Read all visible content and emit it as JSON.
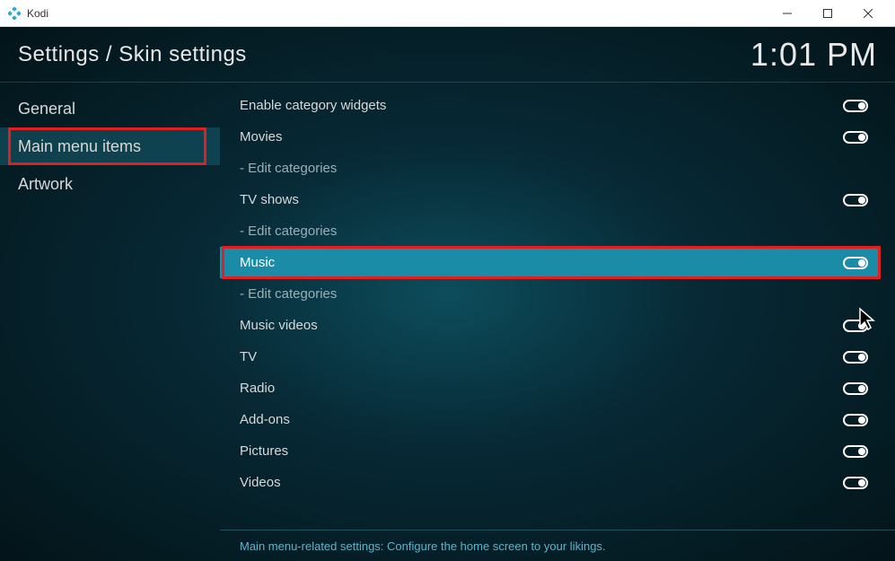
{
  "window": {
    "title": "Kodi"
  },
  "header": {
    "breadcrumb": "Settings / Skin settings",
    "time": "1:01 PM"
  },
  "sidebar": {
    "items": [
      {
        "label": "General",
        "selected": false,
        "highlighted": false
      },
      {
        "label": "Main menu items",
        "selected": true,
        "highlighted": true
      },
      {
        "label": "Artwork",
        "selected": false,
        "highlighted": false
      }
    ]
  },
  "settings": [
    {
      "label": "Enable category widgets",
      "toggle": "on",
      "indent": false,
      "selected": false,
      "highlighted": false
    },
    {
      "label": "Movies",
      "toggle": "on",
      "indent": false,
      "selected": false,
      "highlighted": false
    },
    {
      "label": "- Edit categories",
      "toggle": null,
      "indent": true,
      "selected": false,
      "highlighted": false
    },
    {
      "label": "TV shows",
      "toggle": "on",
      "indent": false,
      "selected": false,
      "highlighted": false
    },
    {
      "label": "- Edit categories",
      "toggle": null,
      "indent": true,
      "selected": false,
      "highlighted": false
    },
    {
      "label": "Music",
      "toggle": "on",
      "indent": false,
      "selected": true,
      "highlighted": true
    },
    {
      "label": "- Edit categories",
      "toggle": null,
      "indent": true,
      "selected": false,
      "highlighted": false
    },
    {
      "label": "Music videos",
      "toggle": "on",
      "indent": false,
      "selected": false,
      "highlighted": false
    },
    {
      "label": "TV",
      "toggle": "on",
      "indent": false,
      "selected": false,
      "highlighted": false
    },
    {
      "label": "Radio",
      "toggle": "on",
      "indent": false,
      "selected": false,
      "highlighted": false
    },
    {
      "label": "Add-ons",
      "toggle": "on",
      "indent": false,
      "selected": false,
      "highlighted": false
    },
    {
      "label": "Pictures",
      "toggle": "on",
      "indent": false,
      "selected": false,
      "highlighted": false
    },
    {
      "label": "Videos",
      "toggle": "on",
      "indent": false,
      "selected": false,
      "highlighted": false
    }
  ],
  "footer": {
    "text": "Main menu-related settings: Configure the home screen to your likings."
  }
}
